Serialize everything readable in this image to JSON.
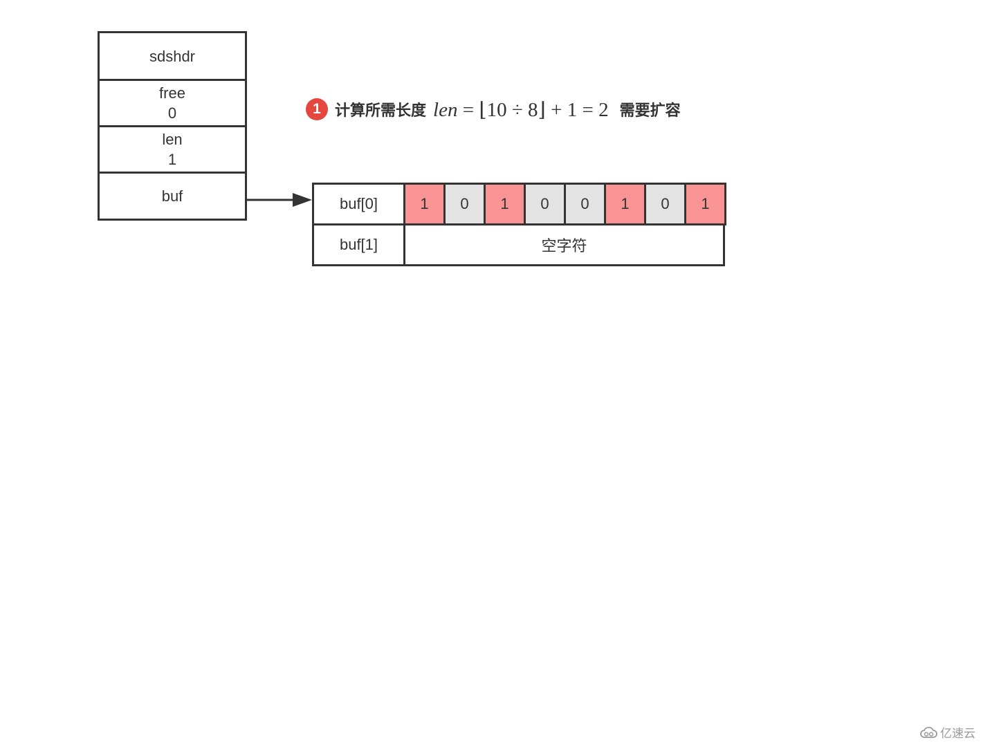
{
  "struct": {
    "header": "sdshdr",
    "free": {
      "label": "free",
      "value": "0"
    },
    "len": {
      "label": "len",
      "value": "1"
    },
    "buf": {
      "label": "buf"
    }
  },
  "annotation": {
    "step_number": "1",
    "prefix_text": "计算所需长度",
    "formula": {
      "var": "len",
      "equals": "=",
      "expression": "⌊10 ÷ 8⌋ + 1 = 2"
    },
    "suffix_text": "需要扩容"
  },
  "buffer": {
    "rows": [
      {
        "label": "buf[0]",
        "bits": [
          "1",
          "0",
          "1",
          "0",
          "0",
          "1",
          "0",
          "1"
        ]
      },
      {
        "label": "buf[1]",
        "content": "空字符"
      }
    ],
    "colors": {
      "one": "#f99494",
      "zero": "#e3e3e3"
    }
  },
  "watermark": {
    "text": "亿速云",
    "icon": "cloud-logo-icon"
  }
}
